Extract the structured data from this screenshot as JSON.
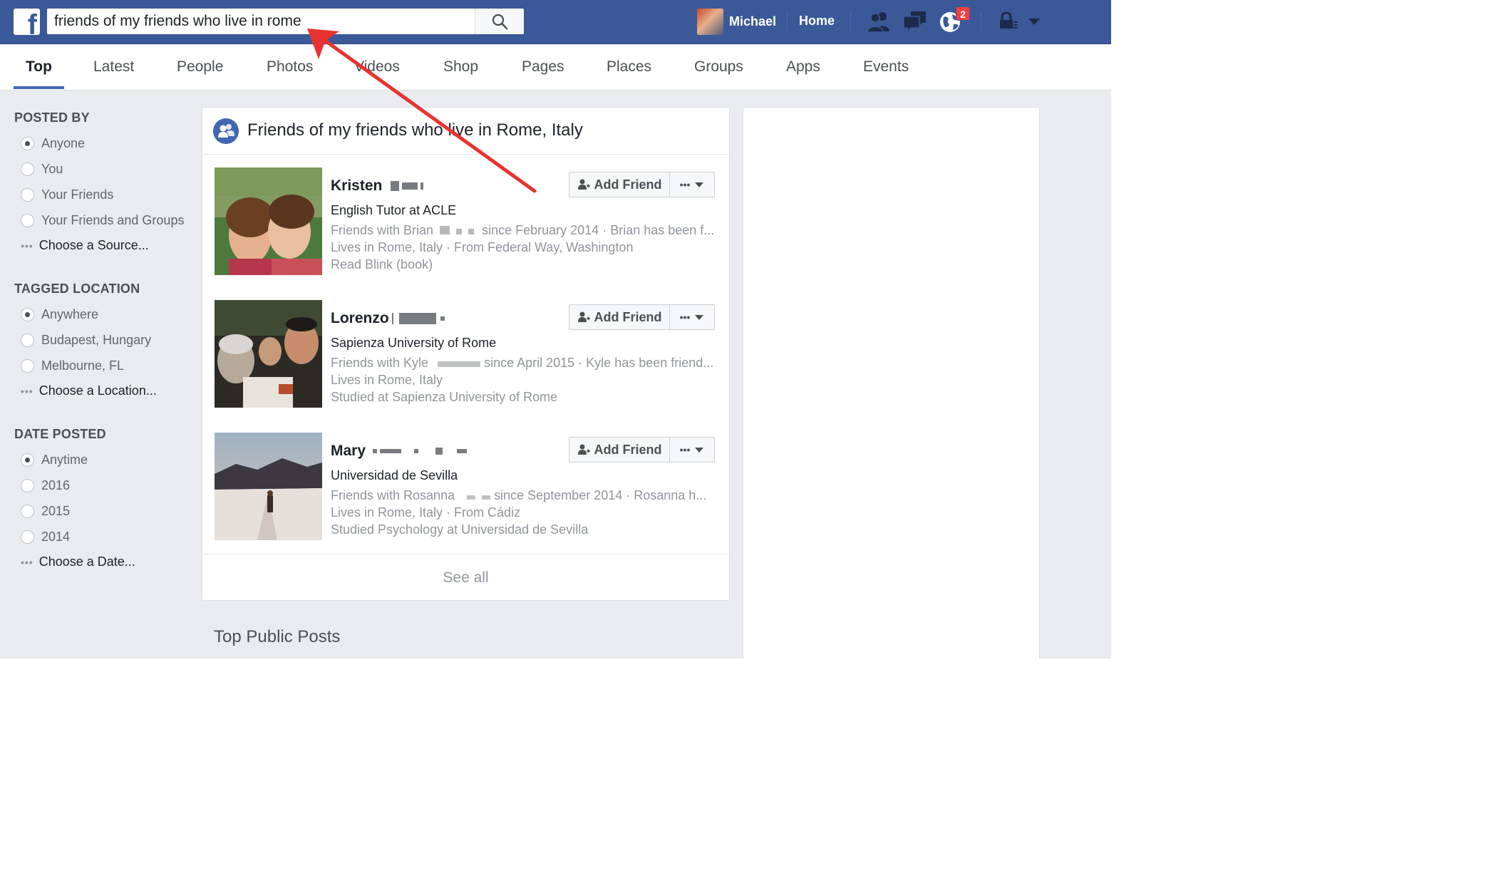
{
  "search": {
    "query": "friends of my friends who live in rome"
  },
  "topbar": {
    "user_name": "Michael",
    "home_label": "Home",
    "notification_count": "2"
  },
  "tabs": [
    {
      "label": "Top",
      "active": true
    },
    {
      "label": "Latest"
    },
    {
      "label": "People"
    },
    {
      "label": "Photos"
    },
    {
      "label": "Videos"
    },
    {
      "label": "Shop"
    },
    {
      "label": "Pages"
    },
    {
      "label": "Places"
    },
    {
      "label": "Groups"
    },
    {
      "label": "Apps"
    },
    {
      "label": "Events"
    }
  ],
  "filters": {
    "posted_by": {
      "heading": "POSTED BY",
      "options": [
        "Anyone",
        "You",
        "Your Friends",
        "Your Friends and Groups"
      ],
      "selected": "Anyone",
      "more": "Choose a Source..."
    },
    "tagged_location": {
      "heading": "TAGGED LOCATION",
      "options": [
        "Anywhere",
        "Budapest, Hungary",
        "Melbourne, FL"
      ],
      "selected": "Anywhere",
      "more": "Choose a Location..."
    },
    "date_posted": {
      "heading": "DATE POSTED",
      "options": [
        "Anytime",
        "2016",
        "2015",
        "2014"
      ],
      "selected": "Anytime",
      "more": "Choose a Date..."
    }
  },
  "results": {
    "title": "Friends of my friends who live in Rome, Italy",
    "add_friend_label": "Add Friend",
    "see_all": "See all",
    "people": [
      {
        "name": "Kristen",
        "work": "English Tutor at ACLE",
        "mutual": "Friends with Brian",
        "mutual_rest": "since February 2014 · Brian has been f...",
        "lives": "Lives in Rome, Italy · From Federal Way, Washington",
        "extra": "Read Blink (book)"
      },
      {
        "name": "Lorenzo",
        "work": "Sapienza University of Rome",
        "mutual": "Friends with Kyle",
        "mutual_rest": "since April 2015 · Kyle has been friend...",
        "lives": "Lives in Rome, Italy",
        "extra": "Studied at Sapienza University of Rome"
      },
      {
        "name": "Mary",
        "work": "Universidad de Sevilla",
        "mutual": "Friends with Rosanna",
        "mutual_rest": "since September 2014 · Rosanna h...",
        "lives": "Lives in Rome, Italy · From Cádiz",
        "extra": "Studied Psychology at Universidad de Sevilla"
      }
    ]
  },
  "section": {
    "top_public_posts": "Top Public Posts"
  },
  "colors": {
    "brand": "#3b5998",
    "accent": "#4267b2",
    "annotation_arrow": "#e8322f"
  }
}
